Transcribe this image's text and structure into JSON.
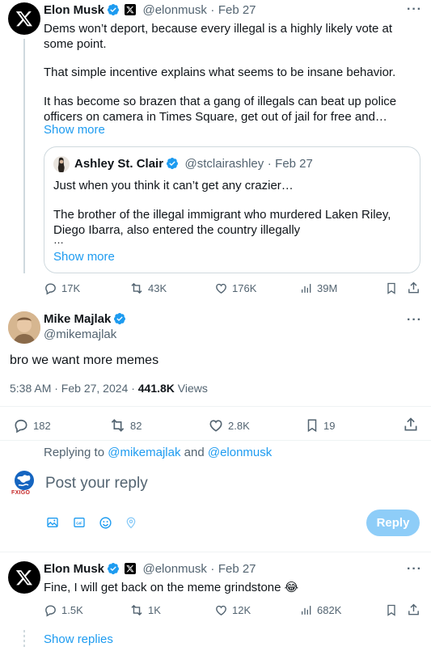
{
  "tweet1": {
    "name": "Elon Musk",
    "handle": "@elonmusk",
    "sep": "·",
    "date": "Feb 27",
    "text_1": "Dems won’t deport, because every illegal is a highly likely vote at some point.",
    "text_2": "That simple incentive explains what seems to be insane behavior.",
    "text_3": "It has become so brazen that a gang of illegals can beat up police officers on camera in Times Square, get out of jail for free and…",
    "show_more": "Show more",
    "quote": {
      "name": "Ashley St. Clair",
      "handle": "@stclairashley",
      "sep": "·",
      "date": "Feb 27",
      "text_1": "Just when you think it can’t get any crazier…",
      "text_2": "The brother of the illegal immigrant who murdered Laken Riley, Diego Ibarra, also entered the country illegally",
      "text_3": "…",
      "show_more": "Show more"
    },
    "actions": {
      "replies": "17K",
      "reposts": "43K",
      "likes": "176K",
      "views": "39M"
    }
  },
  "main": {
    "name": "Mike Majlak",
    "handle": "@mikemajlak",
    "text": "bro we want more memes",
    "time": "5:38 AM · Feb 27, 2024 · ",
    "views_count": "441.8K",
    "views_label": " Views",
    "actions": {
      "replies": "182",
      "reposts": "82",
      "likes": "2.8K",
      "bookmarks": "19"
    }
  },
  "reply_box": {
    "replying_prefix": "Replying to ",
    "replying_user1": "@mikemajlak",
    "replying_and": " and ",
    "replying_user2": "@elonmusk",
    "placeholder": "Post your reply",
    "avatar_text": "FXIGO",
    "reply_button": "Reply"
  },
  "tweet2": {
    "name": "Elon Musk",
    "handle": "@elonmusk",
    "sep": "·",
    "date": "Feb 27",
    "text": "Fine, I will get back on the meme grindstone 😂",
    "actions": {
      "replies": "1.5K",
      "reposts": "1K",
      "likes": "12K",
      "views": "682K"
    },
    "show_replies": "Show replies"
  },
  "colors": {
    "accent": "#1d9bf0",
    "muted": "#536471",
    "reply_button_disabled": "#8ecdf8"
  }
}
